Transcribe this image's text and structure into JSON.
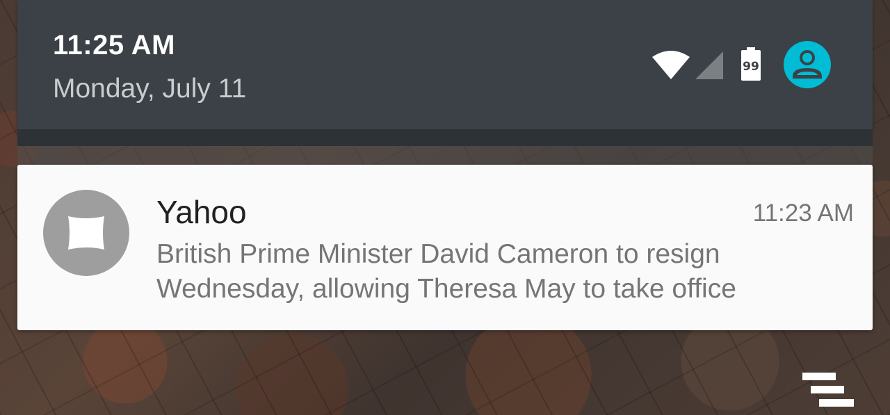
{
  "status_header": {
    "time": "11:25 AM",
    "date": "Monday, July 11",
    "battery_level": "99",
    "icons": [
      "wifi-icon",
      "cell-signal-icon",
      "battery-icon",
      "user-avatar-icon"
    ],
    "accent_color": "#00bcd4"
  },
  "notification": {
    "app_name": "Yahoo",
    "time": "11:23 AM",
    "text_line1": "British Prime Minister David Cameron to resign",
    "text_line2": "Wednesday, allowing Theresa May to take office",
    "icon": "yahoo-app-icon"
  },
  "actions": {
    "clear_all_icon": "clear-all-icon"
  }
}
